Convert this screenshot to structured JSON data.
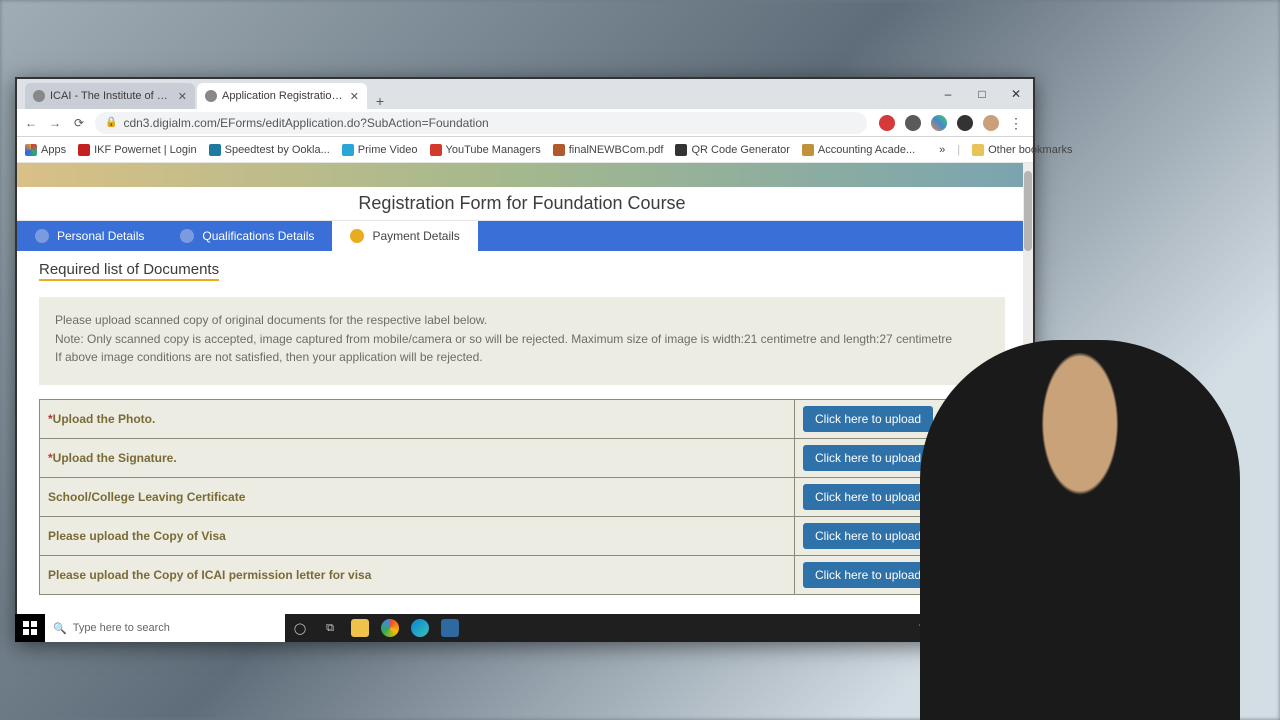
{
  "browser": {
    "tabs": [
      {
        "title": "ICAI - The Institute of Chartered",
        "active": false
      },
      {
        "title": "Application Registration Form",
        "active": true
      }
    ],
    "url": "cdn3.digialm.com/EForms/editApplication.do?SubAction=Foundation",
    "window_controls": {
      "min": "–",
      "max": "□",
      "close": "✕"
    }
  },
  "bookmarks": [
    {
      "label": "Apps",
      "color": "#d24a3a"
    },
    {
      "label": "IKF Powernet | Login",
      "color": "#c32121"
    },
    {
      "label": "Speedtest by Ookla...",
      "color": "#1d7aa0"
    },
    {
      "label": "Prime Video",
      "color": "#2aa6d6"
    },
    {
      "label": "YouTube Managers",
      "color": "#d23a2b"
    },
    {
      "label": "finalNEWBCom.pdf",
      "color": "#b05a2c"
    },
    {
      "label": "QR Code Generator",
      "color": "#333333"
    },
    {
      "label": "Accounting Acade...",
      "color": "#c0933a"
    }
  ],
  "bookmarks_overflow": "»",
  "other_bookmarks": "Other bookmarks",
  "page": {
    "title": "Registration Form for Foundation Course",
    "steps": [
      {
        "label": "Personal Details",
        "active": false
      },
      {
        "label": "Qualifications Details",
        "active": false
      },
      {
        "label": "Payment Details",
        "active": true
      }
    ],
    "docs_heading": "Required list of Documents",
    "instructions": [
      "Please upload scanned copy of original documents for the respective label below.",
      "Note: Only scanned copy is accepted, image captured from mobile/camera or so will be rejected. Maximum size of image is width:21 centimetre and length:27 centimetre",
      "If above image conditions are not satisfied, then your application will be rejected."
    ],
    "upload_button": "Click here to upload",
    "documents": [
      {
        "label": "Upload the Photo.",
        "required": true
      },
      {
        "label": "Upload the Signature.",
        "required": true
      },
      {
        "label": "School/College Leaving Certificate",
        "required": false
      },
      {
        "label": "Please upload the Copy of Visa",
        "required": false
      },
      {
        "label": "Please upload the Copy of ICAI permission letter for visa",
        "required": false
      }
    ],
    "payment_heading": "Payment Details"
  },
  "taskbar": {
    "search_placeholder": "Type here to search"
  }
}
